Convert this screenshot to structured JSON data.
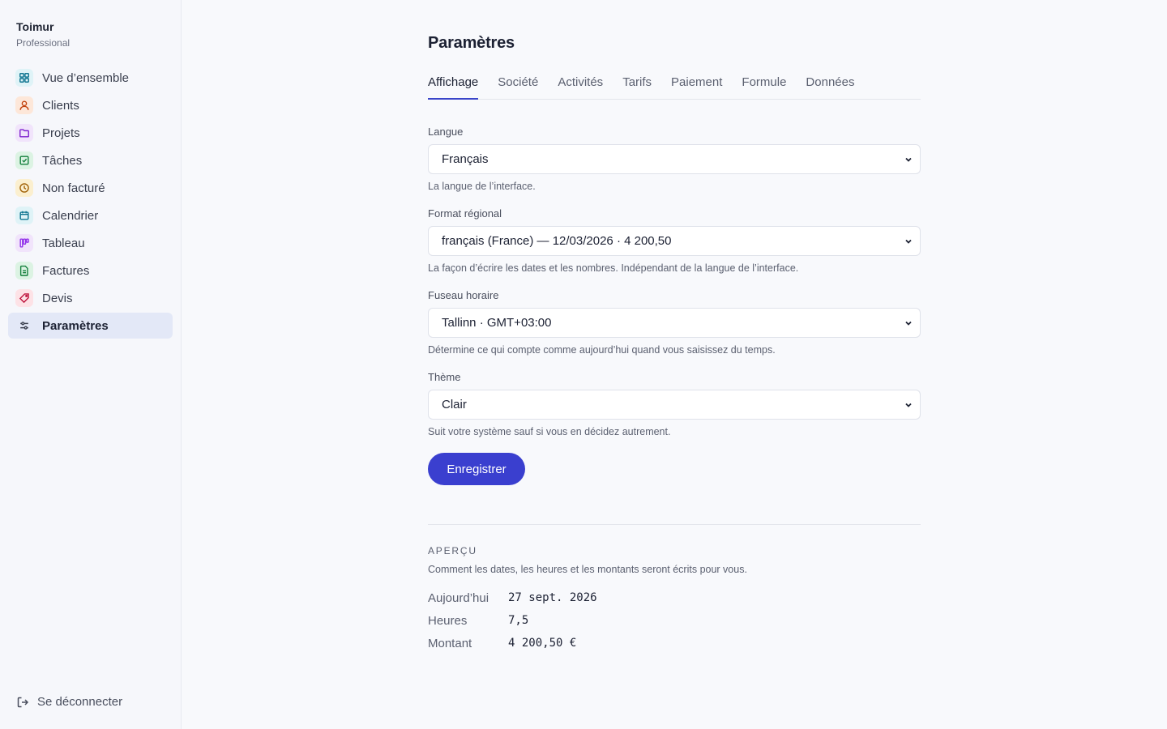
{
  "sidebar": {
    "brand_name": "Toimur",
    "brand_plan": "Professional",
    "items": [
      {
        "label": "Vue d’ensemble",
        "icon": "grid-icon",
        "color": "#0e7490",
        "bg": "#dff3f7"
      },
      {
        "label": "Clients",
        "icon": "user-icon",
        "color": "#c2410c",
        "bg": "#fde7d9"
      },
      {
        "label": "Projets",
        "icon": "folder-icon",
        "color": "#7e22ce",
        "bg": "#f1e4fb"
      },
      {
        "label": "Tâches",
        "icon": "check-square-icon",
        "color": "#15803d",
        "bg": "#dcf3e3"
      },
      {
        "label": "Non facturé",
        "icon": "clock-icon",
        "color": "#a16207",
        "bg": "#fbefcf"
      },
      {
        "label": "Calendrier",
        "icon": "calendar-icon",
        "color": "#0e7490",
        "bg": "#dff3f7"
      },
      {
        "label": "Tableau",
        "icon": "kanban-icon",
        "color": "#9333ea",
        "bg": "#f1e4fb"
      },
      {
        "label": "Factures",
        "icon": "file-icon",
        "color": "#15803d",
        "bg": "#dcf3e3"
      },
      {
        "label": "Devis",
        "icon": "tag-icon",
        "color": "#be123c",
        "bg": "#fde2e6"
      },
      {
        "label": "Paramètres",
        "icon": "sliders-icon",
        "color": "#3a3f4e",
        "bg": "transparent",
        "active": true
      }
    ],
    "logout_label": "Se déconnecter"
  },
  "main": {
    "title": "Paramètres",
    "tabs": [
      "Affichage",
      "Société",
      "Activités",
      "Tarifs",
      "Paiement",
      "Formule",
      "Données"
    ],
    "active_tab": "Affichage",
    "fields": {
      "langue": {
        "label": "Langue",
        "value": "Français",
        "help": "La langue de l’interface."
      },
      "format": {
        "label": "Format régional",
        "value": "français (France) — 12/03/2026 · 4 200,50",
        "help": "La façon d’écrire les dates et les nombres. Indépendant de la langue de l’interface."
      },
      "fuseau": {
        "label": "Fuseau horaire",
        "value": "Tallinn · GMT+03:00",
        "help": "Détermine ce qui compte comme aujourd’hui quand vous saisissez du temps."
      },
      "theme": {
        "label": "Thème",
        "value": "Clair",
        "help": "Suit votre système sauf si vous en décidez autrement."
      }
    },
    "save_label": "Enregistrer",
    "preview": {
      "heading": "APERÇU",
      "subtitle": "Comment les dates, les heures et les montants seront écrits pour vous.",
      "rows": [
        {
          "key": "Aujourd’hui",
          "value": "27 sept. 2026"
        },
        {
          "key": "Heures",
          "value": "7,5"
        },
        {
          "key": "Montant",
          "value": "4 200,50 €"
        }
      ]
    }
  },
  "colors": {
    "accent": "#3a3fcf",
    "active_nav_bg": "#e3e8f7",
    "tab_underline": "#3a45c9"
  }
}
